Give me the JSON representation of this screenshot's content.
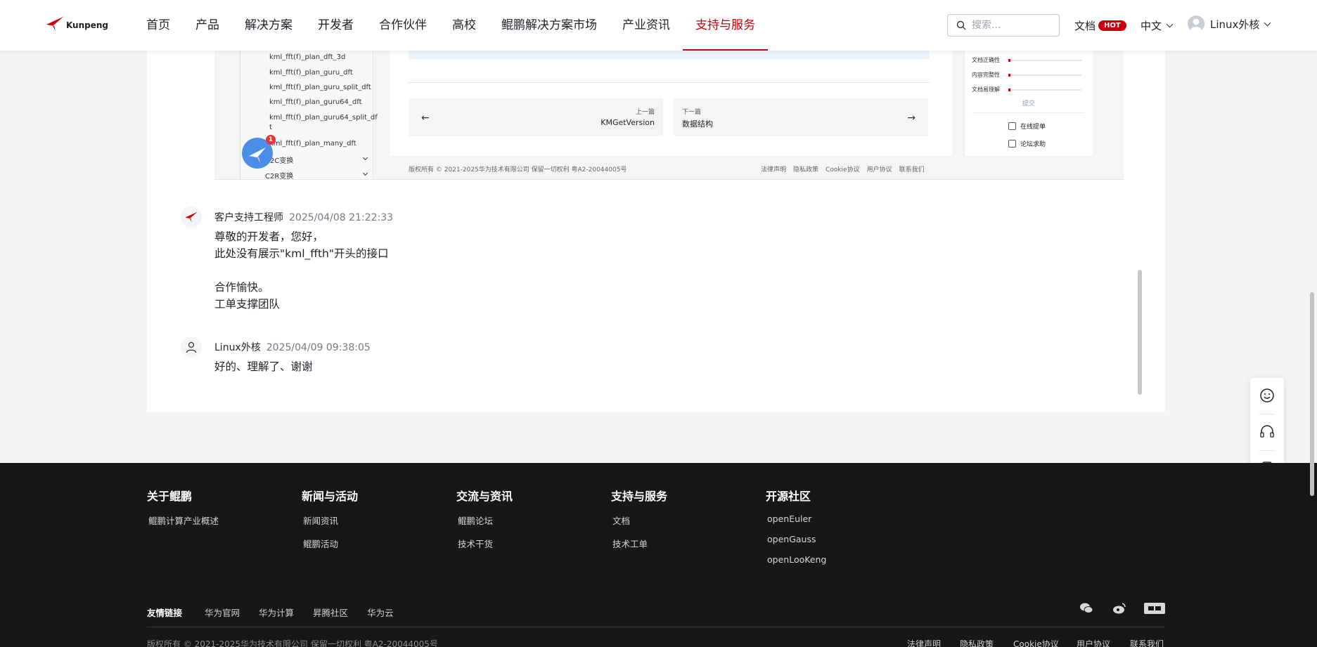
{
  "header": {
    "logo_text": "Kunpeng",
    "nav": [
      "首页",
      "产品",
      "解决方案",
      "开发者",
      "合作伙伴",
      "高校",
      "鲲鹏解决方案市场",
      "产业资讯",
      "支持与服务"
    ],
    "active_nav": "支持与服务",
    "search_placeholder": "搜索...",
    "docs_label": "文档",
    "hot_badge": "HOT",
    "lang": "中文",
    "user_name": "Linux外核"
  },
  "screenshot": {
    "sidebar_items": [
      "kml_fft(f)_plan_dft_3d",
      "kml_fft(f)_plan_guru_dft",
      "kml_fft(f)_plan_guru_split_dft",
      "kml_fft(f)_plan_guru64_dft",
      "kml_fft(f)_plan_guru64_split_df",
      "t",
      "kml_fft(f)_plan_many_dft"
    ],
    "sidebar_groups": [
      "C2C变换",
      "C2R变换"
    ],
    "prev_label": "上一篇",
    "prev_title": "KMGetVersion",
    "next_label": "下一篇",
    "next_title": "数据结构",
    "rating_rows": [
      "文档正确性",
      "内容完整性",
      "文档易理解"
    ],
    "submit": "提交",
    "online_ticket": "在线提单",
    "forum_help": "论坛求助",
    "footer_copyright": "版权所有 © 2021-2025华为技术有限公司 保留一切权利  粤A2-20044005号",
    "footer_links": [
      "法律声明",
      "隐私政策",
      "Cookie协议",
      "用户协议",
      "联系我们"
    ],
    "badge_count": "1"
  },
  "comments": [
    {
      "author": "客户支持工程师",
      "time": "2025/04/08 21:22:33",
      "lines": [
        "尊敬的开发者，您好，",
        "此处没有展示\"kml_ffth\"开头的接口",
        "",
        "合作愉快。",
        "工单支撑团队"
      ]
    },
    {
      "author": "Linux外核",
      "time": "2025/04/09 09:38:05",
      "lines": [
        "好的、理解了、谢谢"
      ]
    }
  ],
  "footer": {
    "columns": [
      {
        "title": "关于鲲鹏",
        "links": [
          "鲲鹏计算产业概述"
        ]
      },
      {
        "title": "新闻与活动",
        "links": [
          "新闻资讯",
          "鲲鹏活动"
        ]
      },
      {
        "title": "交流与资讯",
        "links": [
          "鲲鹏论坛",
          "技术干货"
        ]
      },
      {
        "title": "支持与服务",
        "links": [
          "文档",
          "技术工单"
        ]
      },
      {
        "title": "开源社区",
        "links": [
          "openEuler",
          "openGauss",
          "openLooKeng"
        ]
      }
    ],
    "friend_label": "友情链接",
    "friend_links": [
      "华为官网",
      "华为计算",
      "昇腾社区",
      "华为云"
    ],
    "copyright": "版权所有 © 2021-2025华为技术有限公司 保留一切权利  粤A2-20044005号",
    "legal": [
      "法律声明",
      "隐私政策",
      "Cookie协议",
      "用户协议",
      "联系我们"
    ]
  },
  "colors": {
    "brand": "#c7000b",
    "footer_bg": "#171717"
  }
}
